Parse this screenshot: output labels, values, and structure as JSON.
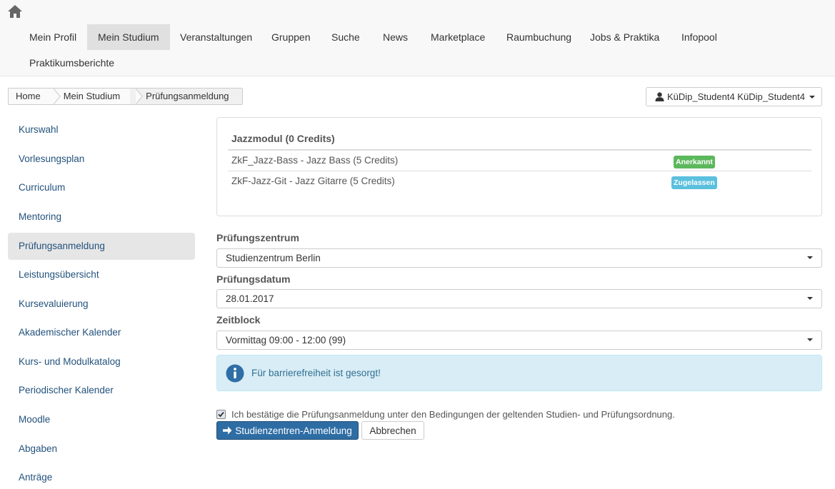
{
  "nav": {
    "home_icon": "home-icon",
    "items": [
      {
        "label": "Mein Profil",
        "active": false
      },
      {
        "label": "Mein Studium",
        "active": true
      },
      {
        "label": "Veranstaltungen",
        "active": false
      },
      {
        "label": "Gruppen",
        "active": false
      },
      {
        "label": "Suche",
        "active": false
      },
      {
        "label": "News",
        "active": false
      },
      {
        "label": "Marketplace",
        "active": false
      },
      {
        "label": "Raumbuchung",
        "active": false
      },
      {
        "label": "Jobs & Praktika",
        "active": false
      },
      {
        "label": "Infopool",
        "active": false
      },
      {
        "label": "Praktikumsberichte",
        "active": false
      }
    ]
  },
  "breadcrumb": [
    "Home",
    "Mein Studium",
    "Prüfungsanmeldung"
  ],
  "user": {
    "name": "KüDip_Student4 KüDip_Student4",
    "icon": "user-icon"
  },
  "sidebar": {
    "items": [
      {
        "label": "Kurswahl",
        "active": false
      },
      {
        "label": "Vorlesungsplan",
        "active": false
      },
      {
        "label": "Curriculum",
        "active": false
      },
      {
        "label": "Mentoring",
        "active": false
      },
      {
        "label": "Prüfungsanmeldung",
        "active": true
      },
      {
        "label": "Leistungsübersicht",
        "active": false
      },
      {
        "label": "Kursevaluierung",
        "active": false
      },
      {
        "label": "Akademischer Kalender",
        "active": false
      },
      {
        "label": "Kurs- und Modulkatalog",
        "active": false
      },
      {
        "label": "Periodischer Kalender",
        "active": false
      },
      {
        "label": "Moodle",
        "active": false
      },
      {
        "label": "Abgaben",
        "active": false
      },
      {
        "label": "Anträge",
        "active": false
      }
    ]
  },
  "module": {
    "title": "Jazzmodul (0 Credits)",
    "rows": [
      {
        "name": "ZkF_Jazz-Bass - Jazz Bass (5 Credits)",
        "status": "Anerkannt",
        "status_color": "#5cb85c"
      },
      {
        "name": "ZkF-Jazz-Git - Jazz Gitarre (5 Credits)",
        "status": "Zugelassen",
        "status_color": "#5bc0de"
      }
    ]
  },
  "form": {
    "center_label": "Prüfungszentrum",
    "center_value": "Studienzentrum Berlin",
    "date_label": "Prüfungsdatum",
    "date_value": "28.01.2017",
    "timeblock_label": "Zeitblock",
    "timeblock_value": "Vormittag 09:00 - 12:00 (99)"
  },
  "alert": {
    "text": "Für barrierefreiheit ist gesorgt!",
    "icon": "info-icon"
  },
  "confirm": {
    "text": "Ich bestätige die Prüfungsanmeldung unter den Bedingungen der geltenden Studien- und Prüfungsordnung.",
    "checked": true
  },
  "buttons": {
    "submit": "Studienzentren-Anmeldung",
    "submit_icon": "arrow-right-icon",
    "cancel": "Abbrechen"
  },
  "colors": {
    "link": "#23527c",
    "primary": "#2e6da4",
    "success": "#5cb85c",
    "info": "#5bc0de"
  }
}
